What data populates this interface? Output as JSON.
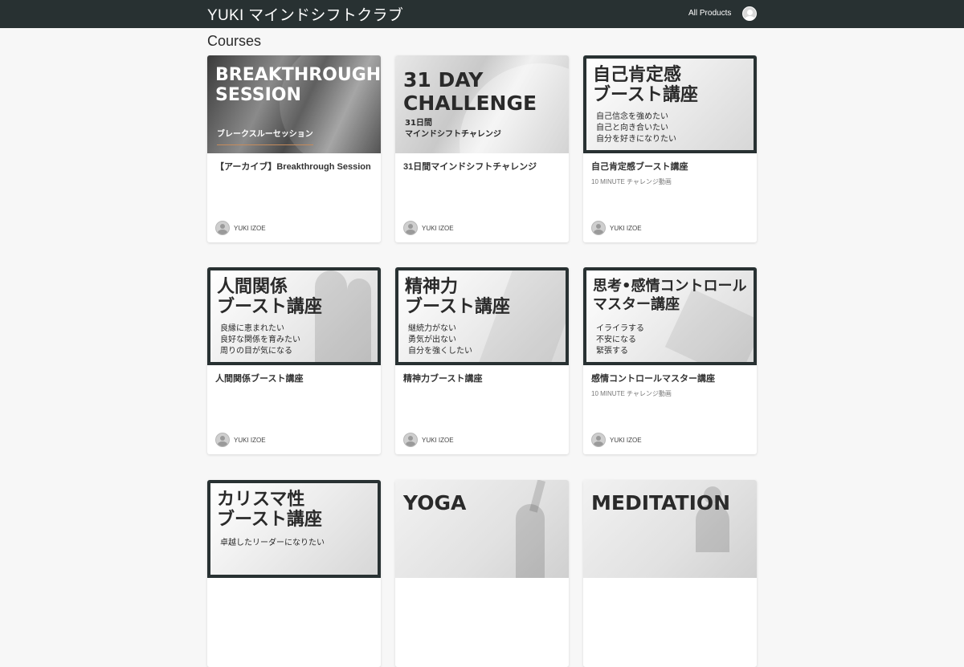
{
  "header": {
    "brand": "YUKI マインドシフトクラブ",
    "nav_all_products": "All Products"
  },
  "section": {
    "title": "Courses"
  },
  "courses": [
    {
      "thumb_title": "BREAKTHROUGH\nSESSION",
      "thumb_sub": "ブレークスルーセッション",
      "title": "【アーカイブ】Breakthrough Session",
      "subtitle": "",
      "author": "YUKI IZOE"
    },
    {
      "thumb_title": "31 DAY\nCHALLENGE",
      "thumb_sub": "31日間\nマインドシフトチャレンジ",
      "title": "31日間マインドシフトチャレンジ",
      "subtitle": "",
      "author": "YUKI IZOE"
    },
    {
      "thumb_title": "自己肯定感\nブースト講座",
      "thumb_sub": "自己信念を強めたい\n自己と向き合いたい\n自分を好きになりたい",
      "title": "自己肯定感ブースト講座",
      "subtitle": "10 MINUTE チャレンジ動画",
      "author": "YUKI IZOE"
    },
    {
      "thumb_title": "人間関係\nブースト講座",
      "thumb_sub": "良縁に恵まれたい\n良好な関係を育みたい\n周りの目が気になる",
      "title": "人間関係ブースト講座",
      "subtitle": "",
      "author": "YUKI IZOE"
    },
    {
      "thumb_title": "精神力\nブースト講座",
      "thumb_sub": "継続力がない\n勇気が出ない\n自分を強くしたい",
      "title": "精神力ブースト講座",
      "subtitle": "",
      "author": "YUKI IZOE"
    },
    {
      "thumb_title": "思考•感情コントロール\nマスター講座",
      "thumb_sub": "イライラする\n不安になる\n緊張する",
      "title": "感情コントロールマスター講座",
      "subtitle": "10 MINUTE チャレンジ動画",
      "author": "YUKI IZOE"
    },
    {
      "thumb_title": "カリスマ性\nブースト講座",
      "thumb_sub": "卓越したリーダーになりたい",
      "title": "",
      "subtitle": "",
      "author": ""
    },
    {
      "thumb_title": "YOGA",
      "thumb_sub": "",
      "title": "",
      "subtitle": "",
      "author": ""
    },
    {
      "thumb_title": "MEDITATION",
      "thumb_sub": "",
      "title": "",
      "subtitle": "",
      "author": ""
    }
  ]
}
